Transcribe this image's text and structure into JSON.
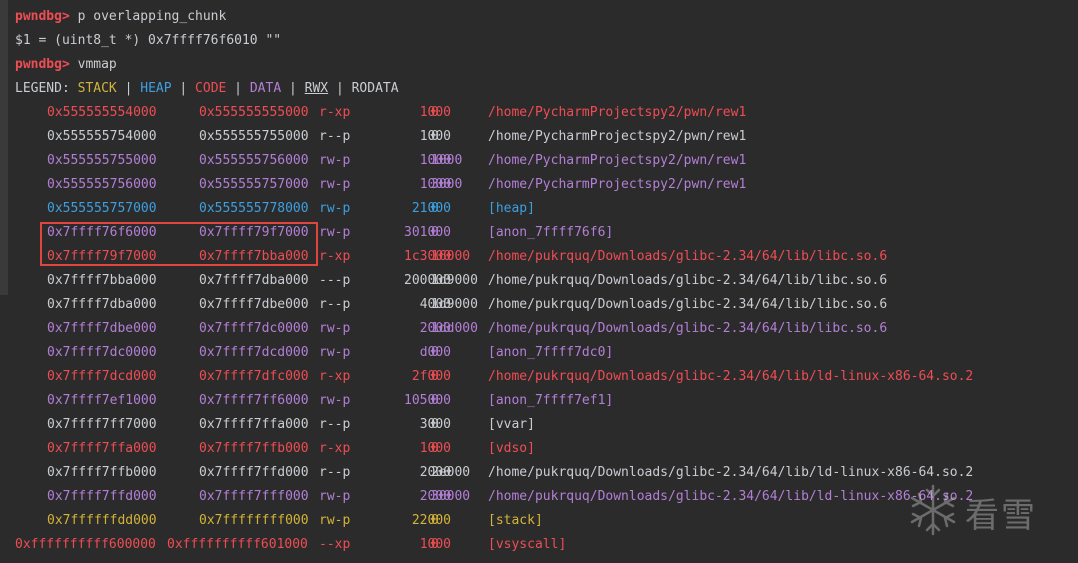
{
  "terminal": {
    "cmd1": {
      "prompt": "pwndbg>",
      "command": " p overlapping_chunk"
    },
    "output1": "$1 = (uint8_t *) 0x7ffff76f6010 \"\"",
    "cmd2": {
      "prompt": "pwndbg>",
      "command": " vmmap"
    },
    "legend": {
      "label": "LEGEND: ",
      "stack": "STACK",
      "heap": "HEAP",
      "code": "CODE",
      "data": "DATA",
      "rwx": "RWX",
      "rodata": "RODATA",
      "sep": " | "
    }
  },
  "vmmap": [
    {
      "start": "0x555555554000",
      "end": "0x555555555000",
      "perm": "r-xp",
      "size": "1000",
      "offset": "0",
      "objfile": "/home/PycharmProjectspy2/pwn/rew1",
      "type": "code"
    },
    {
      "start": "0x555555754000",
      "end": "0x555555755000",
      "perm": "r--p",
      "size": "1000",
      "offset": "0",
      "objfile": "/home/PycharmProjectspy2/pwn/rew1",
      "type": "plain"
    },
    {
      "start": "0x555555755000",
      "end": "0x555555756000",
      "perm": "rw-p",
      "size": "1000",
      "offset": "1000",
      "objfile": "/home/PycharmProjectspy2/pwn/rew1",
      "type": "data"
    },
    {
      "start": "0x555555756000",
      "end": "0x555555757000",
      "perm": "rw-p",
      "size": "1000",
      "offset": "3000",
      "objfile": "/home/PycharmProjectspy2/pwn/rew1",
      "type": "data"
    },
    {
      "start": "0x555555757000",
      "end": "0x555555778000",
      "perm": "rw-p",
      "size": "21000",
      "offset": "0",
      "objfile": "[heap]",
      "type": "heap"
    },
    {
      "start": "0x7ffff76f6000",
      "end": "0x7ffff79f7000",
      "perm": "rw-p",
      "size": "301000",
      "offset": "0",
      "objfile": "[anon_7ffff76f6]",
      "type": "data"
    },
    {
      "start": "0x7ffff79f7000",
      "end": "0x7ffff7bba000",
      "perm": "r-xp",
      "size": "1c3000",
      "offset": "16000",
      "objfile": "/home/pukrquq/Downloads/glibc-2.34/64/lib/libc.so.6",
      "type": "code"
    },
    {
      "start": "0x7ffff7bba000",
      "end": "0x7ffff7dba000",
      "perm": "---p",
      "size": "200000",
      "offset": "1d9000",
      "objfile": "/home/pukrquq/Downloads/glibc-2.34/64/lib/libc.so.6",
      "type": "plain"
    },
    {
      "start": "0x7ffff7dba000",
      "end": "0x7ffff7dbe000",
      "perm": "r--p",
      "size": "4000",
      "offset": "1d9000",
      "objfile": "/home/pukrquq/Downloads/glibc-2.34/64/lib/libc.so.6",
      "type": "plain"
    },
    {
      "start": "0x7ffff7dbe000",
      "end": "0x7ffff7dc0000",
      "perm": "rw-p",
      "size": "2000",
      "offset": "1dd000",
      "objfile": "/home/pukrquq/Downloads/glibc-2.34/64/lib/libc.so.6",
      "type": "data"
    },
    {
      "start": "0x7ffff7dc0000",
      "end": "0x7ffff7dcd000",
      "perm": "rw-p",
      "size": "d000",
      "offset": "0",
      "objfile": "[anon_7ffff7dc0]",
      "type": "data"
    },
    {
      "start": "0x7ffff7dcd000",
      "end": "0x7ffff7dfc000",
      "perm": "r-xp",
      "size": "2f000",
      "offset": "0",
      "objfile": "/home/pukrquq/Downloads/glibc-2.34/64/lib/ld-linux-x86-64.so.2",
      "type": "code"
    },
    {
      "start": "0x7ffff7ef1000",
      "end": "0x7ffff7ff6000",
      "perm": "rw-p",
      "size": "105000",
      "offset": "0",
      "objfile": "[anon_7ffff7ef1]",
      "type": "data"
    },
    {
      "start": "0x7ffff7ff7000",
      "end": "0x7ffff7ffa000",
      "perm": "r--p",
      "size": "3000",
      "offset": "0",
      "objfile": "[vvar]",
      "type": "plain"
    },
    {
      "start": "0x7ffff7ffa000",
      "end": "0x7ffff7ffb000",
      "perm": "r-xp",
      "size": "1000",
      "offset": "0",
      "objfile": "[vdso]",
      "type": "code"
    },
    {
      "start": "0x7ffff7ffb000",
      "end": "0x7ffff7ffd000",
      "perm": "r--p",
      "size": "2000",
      "offset": "2e000",
      "objfile": "/home/pukrquq/Downloads/glibc-2.34/64/lib/ld-linux-x86-64.so.2",
      "type": "plain"
    },
    {
      "start": "0x7ffff7ffd000",
      "end": "0x7ffff7fff000",
      "perm": "rw-p",
      "size": "2000",
      "offset": "30000",
      "objfile": "/home/pukrquq/Downloads/glibc-2.34/64/lib/ld-linux-x86-64.so.2",
      "type": "data"
    },
    {
      "start": "0x7ffffffdd000",
      "end": "0x7ffffffff000",
      "perm": "rw-p",
      "size": "22000",
      "offset": "0",
      "objfile": "[stack]",
      "type": "stack"
    },
    {
      "start": "0xffffffffff600000",
      "end": "0xffffffffff601000",
      "perm": "--xp",
      "size": "1000",
      "offset": "0",
      "objfile": "[vsyscall]",
      "type": "code",
      "wide": true
    }
  ],
  "watermark": {
    "text": "看雪",
    "icon": "snowflake-icon"
  }
}
